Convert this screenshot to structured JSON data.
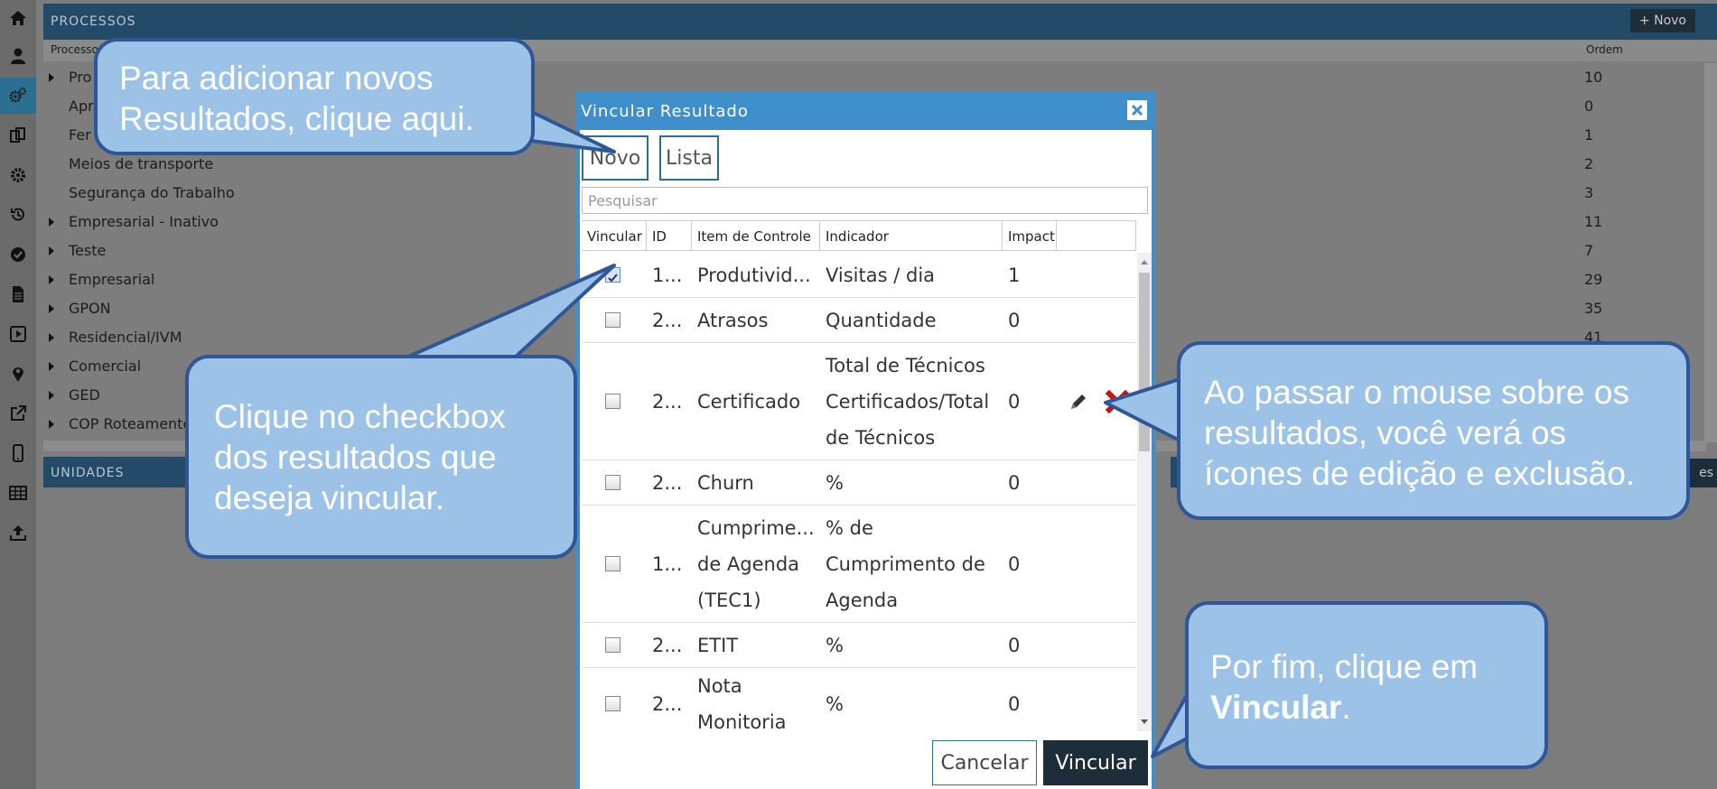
{
  "sidebar": {
    "icons": [
      "home-icon",
      "user-icon",
      "gears-icon",
      "copy-icon",
      "gear-icon",
      "history-icon",
      "check-circle-icon",
      "document-icon",
      "play-icon",
      "map-marker-icon",
      "external-link-icon",
      "mobile-icon",
      "table-icon",
      "upload-icon"
    ]
  },
  "processes": {
    "title": "PROCESSOS",
    "new_label": "+ Novo",
    "col_process": "Processo",
    "col_order": "Ordem",
    "rows": [
      {
        "label": "Pro",
        "order": "10",
        "expandable": true
      },
      {
        "label": "Apr",
        "order": "0",
        "expandable": false
      },
      {
        "label": "Fer",
        "order": "1",
        "expandable": false
      },
      {
        "label": "Meios de transporte",
        "order": "2",
        "expandable": false
      },
      {
        "label": "Segurança do Trabalho",
        "order": "3",
        "expandable": false
      },
      {
        "label": "Empresarial - Inativo",
        "order": "11",
        "expandable": true
      },
      {
        "label": "Teste",
        "order": "7",
        "expandable": true
      },
      {
        "label": "Empresarial",
        "order": "29",
        "expandable": true
      },
      {
        "label": "GPON",
        "order": "35",
        "expandable": true
      },
      {
        "label": "Residencial/IVM",
        "order": "41",
        "expandable": true
      },
      {
        "label": "Comercial",
        "order": "",
        "expandable": true
      },
      {
        "label": "GED",
        "order": "",
        "expandable": true
      },
      {
        "label": "COP Roteamento",
        "order": "",
        "expandable": true
      }
    ]
  },
  "units": {
    "title": "UNIDADES",
    "right_tab": "es"
  },
  "modal": {
    "title": "Vincular Resultado",
    "tab_new": "Novo",
    "tab_list": "Lista",
    "search_placeholder": "Pesquisar",
    "headers": {
      "vincular": "Vincular",
      "id": "ID",
      "item": "Item de Controle",
      "indicador": "Indicador",
      "impacto": "Impact"
    },
    "rows": [
      {
        "checked": true,
        "id": "1...",
        "item": "Produtivid...",
        "indicador": "Visitas / dia",
        "impacto": "1"
      },
      {
        "checked": false,
        "id": "2...",
        "item": "Atrasos",
        "indicador": "Quantidade",
        "impacto": "0"
      },
      {
        "checked": false,
        "id": "2...",
        "item": "Certificado",
        "indicador": "Total de Técnicos Certificados/Total de Técnicos",
        "impacto": "0",
        "actions": true
      },
      {
        "checked": false,
        "id": "2...",
        "item": "Churn",
        "indicador": "%",
        "impacto": "0"
      },
      {
        "checked": false,
        "id": "1...",
        "item": "Cumprime... de Agenda (TEC1)",
        "indicador": "% de Cumprimento de Agenda",
        "impacto": "0"
      },
      {
        "checked": false,
        "id": "2...",
        "item": "ETIT",
        "indicador": "%",
        "impacto": "0"
      },
      {
        "checked": false,
        "id": "2...",
        "item": "Nota Monitoria",
        "indicador": "%",
        "impacto": "0"
      }
    ],
    "cancel_label": "Cancelar",
    "confirm_label": "Vincular"
  },
  "callouts": {
    "add_new": "Para adicionar novos Resultados, clique aqui.",
    "checkbox": "Clique no checkbox dos resultados que deseja vincular.",
    "hover": "Ao passar o mouse sobre os resultados, você verá os ícones de edição e exclusão.",
    "finish_prefix": "Por fim, clique em ",
    "finish_bold": "Vincular",
    "finish_suffix": "."
  },
  "colors": {
    "accent": "#3e8fcc",
    "dark_button": "#1e2d3a",
    "callout_fill": "#9cc3e7",
    "callout_border": "#2f5797",
    "delete_red": "#cc1111"
  }
}
